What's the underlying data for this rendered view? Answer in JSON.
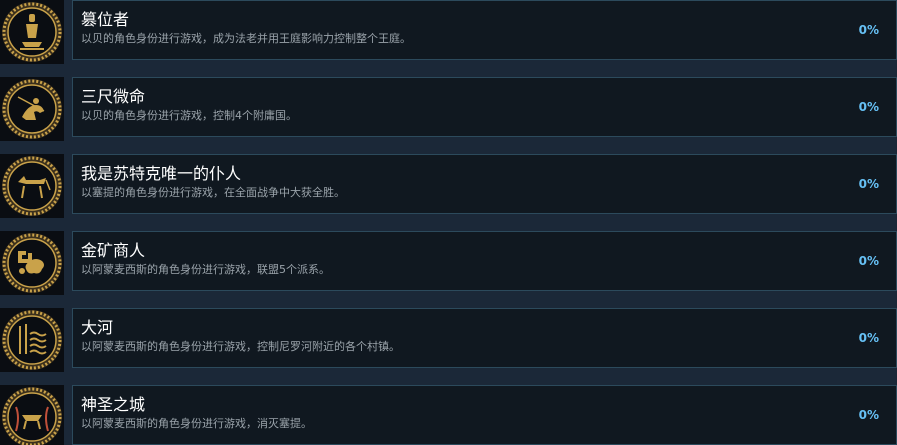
{
  "colors": {
    "background": "#1b2838",
    "panel": "#101820",
    "panel_border": "#2c4a5c",
    "title": "#ffffff",
    "description": "#9aa3aa",
    "percent": "#66c0f4",
    "badge_gold": "#c9a24a",
    "badge_dark": "#0a0d12"
  },
  "achievements": [
    {
      "icon": "crowned-figure-icon",
      "title": "篡位者",
      "description": "以贝的角色身份进行游戏，成为法老并用王庭影响力控制整个王庭。",
      "percent": "0%"
    },
    {
      "icon": "crouching-soldier-icon",
      "title": "三尺微命",
      "description": "以贝的角色身份进行游戏，控制4个附庸国。",
      "percent": "0%"
    },
    {
      "icon": "jackal-icon",
      "title": "我是苏特克唯一的仆人",
      "description": "以塞提的角色身份进行游戏，在全面战争中大获全胜。",
      "percent": "0%"
    },
    {
      "icon": "gold-nuggets-icon",
      "title": "金矿商人",
      "description": "以阿蒙麦西斯的角色身份进行游戏，联盟5个派系。",
      "percent": "0%"
    },
    {
      "icon": "river-waves-icon",
      "title": "大河",
      "description": "以阿蒙麦西斯的角色身份进行游戏，控制尼罗河附近的各个村镇。",
      "percent": "0%"
    },
    {
      "icon": "sacred-beast-icon",
      "title": "神圣之城",
      "description": "以阿蒙麦西斯的角色身份进行游戏，消灭塞提。",
      "percent": "0%"
    }
  ]
}
